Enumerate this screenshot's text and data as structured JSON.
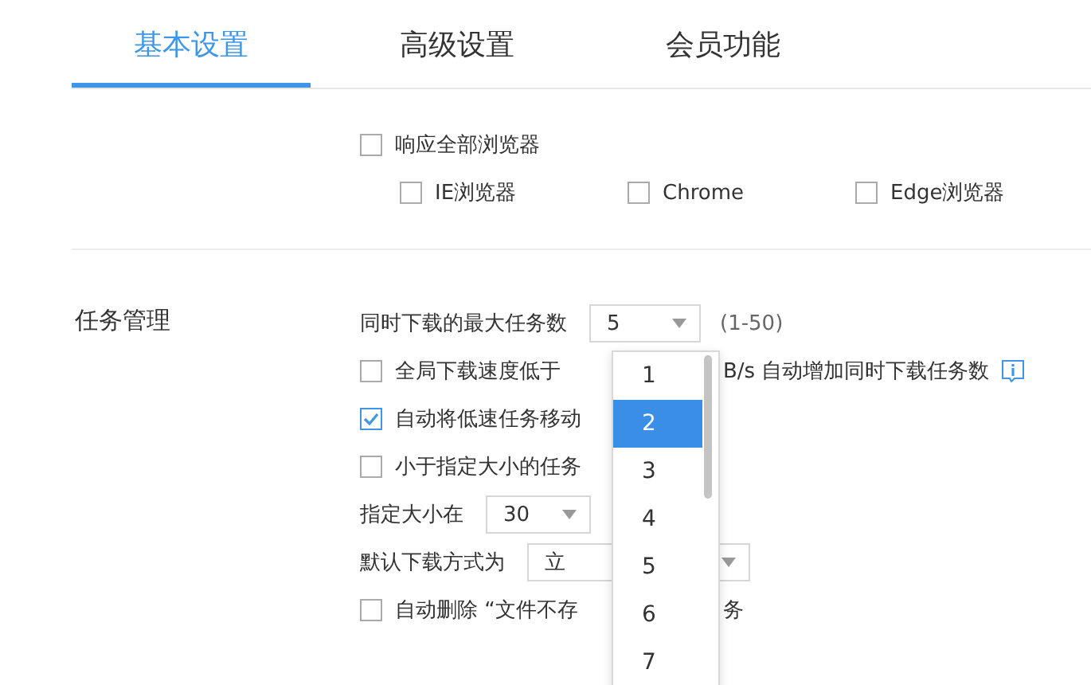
{
  "tabs": [
    {
      "label": "基本设置",
      "selected": true
    },
    {
      "label": "高级设置",
      "selected": false
    },
    {
      "label": "会员功能",
      "selected": false
    }
  ],
  "browser_section": {
    "option": {
      "label": "响应全部浏览器",
      "checked": false
    },
    "browsers": [
      {
        "label": "IE浏览器",
        "checked": false
      },
      {
        "label": "Chrome",
        "checked": false
      },
      {
        "label": "Edge浏览器",
        "checked": false
      }
    ]
  },
  "task_section": {
    "title": "任务管理",
    "rows": [
      {
        "kind": "select",
        "label": "同时下载的最大任务数",
        "value": "5",
        "hint": "(1-50)"
      },
      {
        "kind": "checkbox",
        "checked": false,
        "label": "全局下载速度低于",
        "after": "B/s 自动增加同时下载任务数",
        "info": true
      },
      {
        "kind": "checkbox",
        "checked": true,
        "label": "自动将低速任务移动"
      },
      {
        "kind": "checkbox",
        "checked": false,
        "label": "小于指定大小的任务"
      },
      {
        "kind": "select",
        "label": "指定大小在",
        "value": "30"
      },
      {
        "kind": "select",
        "label": "默认下载方式为",
        "value": "立"
      },
      {
        "kind": "checkbox",
        "checked": false,
        "label": "自动删除 “文件不存",
        "after": "务"
      }
    ]
  },
  "dropdown": {
    "items": [
      {
        "label": "1",
        "selected": false
      },
      {
        "label": "2",
        "selected": true
      },
      {
        "label": "3",
        "selected": false
      },
      {
        "label": "4",
        "selected": false
      },
      {
        "label": "5",
        "selected": false
      },
      {
        "label": "6",
        "selected": false
      },
      {
        "label": "7",
        "selected": false
      }
    ]
  }
}
